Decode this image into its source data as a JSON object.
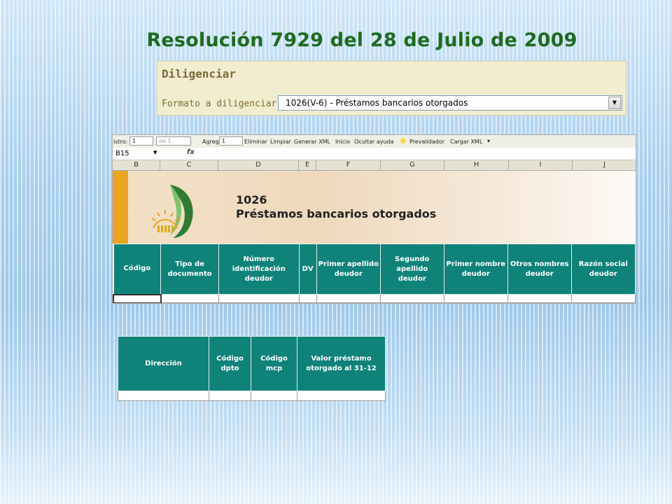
{
  "slide": {
    "title": "Resolución 7929 del 28 de Julio de 2009"
  },
  "dilig": {
    "title": "Diligenciar",
    "label": "Formato a diligenciar:",
    "selected": "1026(V-6) - Préstamos bancarios otorgados",
    "arrow_icon": "dropdown-arrow-icon"
  },
  "toolbar": {
    "registro_label": "istro:",
    "registro_value": "1",
    "de_value": "de 1",
    "agregar_label": "Agregar",
    "agregar_value": "1",
    "eliminar": "Eliminar",
    "limpiar": "Limpiar",
    "generar_xml": "Generar XML",
    "inicio": "Inicio",
    "ocultar_ayuda": "Ocultar ayuda",
    "prevalidador": "Prevalidador",
    "cargar_xml": "Cargar XML"
  },
  "formula": {
    "cell": "B15",
    "fx": "fx"
  },
  "columns": [
    "B",
    "C",
    "D",
    "E",
    "F",
    "G",
    "H",
    "I",
    "J"
  ],
  "banner": {
    "code": "1026",
    "name": "Préstamos bancarios otorgados",
    "accent": "#e9a51d"
  },
  "table1": {
    "headers": [
      "Código",
      "Tipo de documento",
      "Número identificación deudor",
      "DV",
      "Primer apellido deudor",
      "Segundo apellido deudor",
      "Primer nombre deudor",
      "Otros nombres deudor",
      "Razón social deudor"
    ]
  },
  "table2": {
    "headers": [
      "Dirección",
      "Código dpto",
      "Código mcp",
      "Valor préstamo otorgado al 31-12"
    ]
  },
  "colors": {
    "title": "#1e6b1f",
    "header_bg": "#0f827a",
    "panel_bg": "#f3edcf"
  }
}
